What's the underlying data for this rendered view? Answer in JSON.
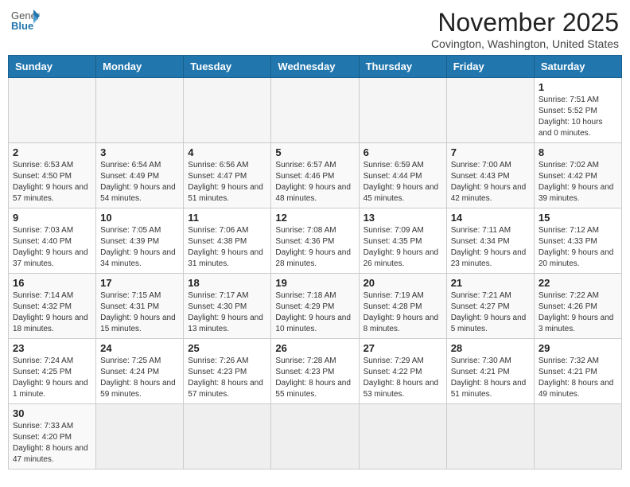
{
  "header": {
    "logo_general": "General",
    "logo_blue": "Blue",
    "month_title": "November 2025",
    "location": "Covington, Washington, United States"
  },
  "weekdays": [
    "Sunday",
    "Monday",
    "Tuesday",
    "Wednesday",
    "Thursday",
    "Friday",
    "Saturday"
  ],
  "weeks": [
    [
      {
        "day": "",
        "info": ""
      },
      {
        "day": "",
        "info": ""
      },
      {
        "day": "",
        "info": ""
      },
      {
        "day": "",
        "info": ""
      },
      {
        "day": "",
        "info": ""
      },
      {
        "day": "",
        "info": ""
      },
      {
        "day": "1",
        "info": "Sunrise: 7:51 AM\nSunset: 5:52 PM\nDaylight: 10 hours and 0 minutes."
      }
    ],
    [
      {
        "day": "2",
        "info": "Sunrise: 6:53 AM\nSunset: 4:50 PM\nDaylight: 9 hours and 57 minutes."
      },
      {
        "day": "3",
        "info": "Sunrise: 6:54 AM\nSunset: 4:49 PM\nDaylight: 9 hours and 54 minutes."
      },
      {
        "day": "4",
        "info": "Sunrise: 6:56 AM\nSunset: 4:47 PM\nDaylight: 9 hours and 51 minutes."
      },
      {
        "day": "5",
        "info": "Sunrise: 6:57 AM\nSunset: 4:46 PM\nDaylight: 9 hours and 48 minutes."
      },
      {
        "day": "6",
        "info": "Sunrise: 6:59 AM\nSunset: 4:44 PM\nDaylight: 9 hours and 45 minutes."
      },
      {
        "day": "7",
        "info": "Sunrise: 7:00 AM\nSunset: 4:43 PM\nDaylight: 9 hours and 42 minutes."
      },
      {
        "day": "8",
        "info": "Sunrise: 7:02 AM\nSunset: 4:42 PM\nDaylight: 9 hours and 39 minutes."
      }
    ],
    [
      {
        "day": "9",
        "info": "Sunrise: 7:03 AM\nSunset: 4:40 PM\nDaylight: 9 hours and 37 minutes."
      },
      {
        "day": "10",
        "info": "Sunrise: 7:05 AM\nSunset: 4:39 PM\nDaylight: 9 hours and 34 minutes."
      },
      {
        "day": "11",
        "info": "Sunrise: 7:06 AM\nSunset: 4:38 PM\nDaylight: 9 hours and 31 minutes."
      },
      {
        "day": "12",
        "info": "Sunrise: 7:08 AM\nSunset: 4:36 PM\nDaylight: 9 hours and 28 minutes."
      },
      {
        "day": "13",
        "info": "Sunrise: 7:09 AM\nSunset: 4:35 PM\nDaylight: 9 hours and 26 minutes."
      },
      {
        "day": "14",
        "info": "Sunrise: 7:11 AM\nSunset: 4:34 PM\nDaylight: 9 hours and 23 minutes."
      },
      {
        "day": "15",
        "info": "Sunrise: 7:12 AM\nSunset: 4:33 PM\nDaylight: 9 hours and 20 minutes."
      }
    ],
    [
      {
        "day": "16",
        "info": "Sunrise: 7:14 AM\nSunset: 4:32 PM\nDaylight: 9 hours and 18 minutes."
      },
      {
        "day": "17",
        "info": "Sunrise: 7:15 AM\nSunset: 4:31 PM\nDaylight: 9 hours and 15 minutes."
      },
      {
        "day": "18",
        "info": "Sunrise: 7:17 AM\nSunset: 4:30 PM\nDaylight: 9 hours and 13 minutes."
      },
      {
        "day": "19",
        "info": "Sunrise: 7:18 AM\nSunset: 4:29 PM\nDaylight: 9 hours and 10 minutes."
      },
      {
        "day": "20",
        "info": "Sunrise: 7:19 AM\nSunset: 4:28 PM\nDaylight: 9 hours and 8 minutes."
      },
      {
        "day": "21",
        "info": "Sunrise: 7:21 AM\nSunset: 4:27 PM\nDaylight: 9 hours and 5 minutes."
      },
      {
        "day": "22",
        "info": "Sunrise: 7:22 AM\nSunset: 4:26 PM\nDaylight: 9 hours and 3 minutes."
      }
    ],
    [
      {
        "day": "23",
        "info": "Sunrise: 7:24 AM\nSunset: 4:25 PM\nDaylight: 9 hours and 1 minute."
      },
      {
        "day": "24",
        "info": "Sunrise: 7:25 AM\nSunset: 4:24 PM\nDaylight: 8 hours and 59 minutes."
      },
      {
        "day": "25",
        "info": "Sunrise: 7:26 AM\nSunset: 4:23 PM\nDaylight: 8 hours and 57 minutes."
      },
      {
        "day": "26",
        "info": "Sunrise: 7:28 AM\nSunset: 4:23 PM\nDaylight: 8 hours and 55 minutes."
      },
      {
        "day": "27",
        "info": "Sunrise: 7:29 AM\nSunset: 4:22 PM\nDaylight: 8 hours and 53 minutes."
      },
      {
        "day": "28",
        "info": "Sunrise: 7:30 AM\nSunset: 4:21 PM\nDaylight: 8 hours and 51 minutes."
      },
      {
        "day": "29",
        "info": "Sunrise: 7:32 AM\nSunset: 4:21 PM\nDaylight: 8 hours and 49 minutes."
      }
    ],
    [
      {
        "day": "30",
        "info": "Sunrise: 7:33 AM\nSunset: 4:20 PM\nDaylight: 8 hours and 47 minutes."
      },
      {
        "day": "",
        "info": ""
      },
      {
        "day": "",
        "info": ""
      },
      {
        "day": "",
        "info": ""
      },
      {
        "day": "",
        "info": ""
      },
      {
        "day": "",
        "info": ""
      },
      {
        "day": "",
        "info": ""
      }
    ]
  ]
}
